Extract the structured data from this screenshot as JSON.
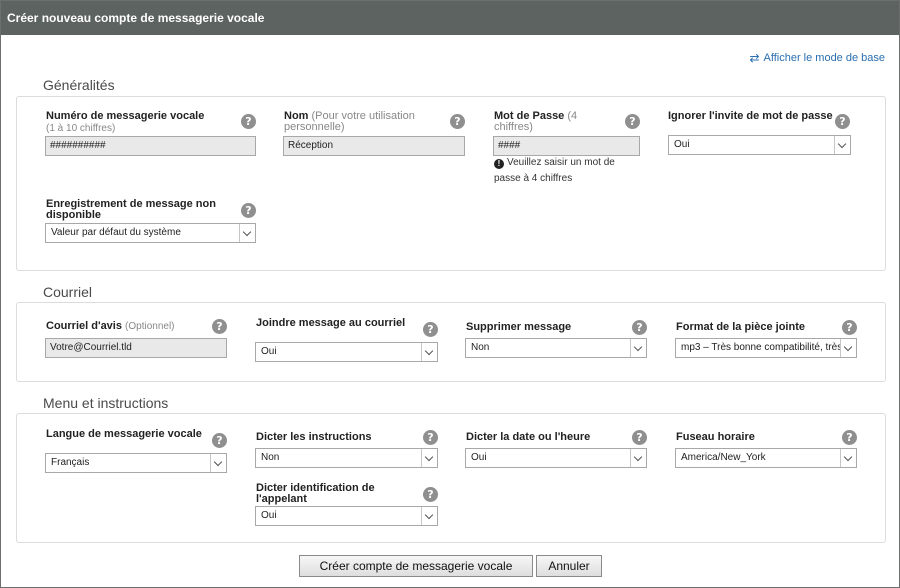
{
  "dialog": {
    "title": "Créer nouveau compte de messagerie vocale",
    "basic_mode_link": "Afficher le mode de base"
  },
  "general": {
    "title": "Généralités",
    "mailbox_number": {
      "label": "Numéro de messagerie vocale",
      "hint": "(1 à 10 chiffres)",
      "value": "##########"
    },
    "name": {
      "label": "Nom",
      "hint": "(Pour votre utilisation personnelle)",
      "value": "Réception"
    },
    "password": {
      "label": "Mot de Passe",
      "hint": "(4 chiffres)",
      "value": "####",
      "warning": "Veuillez saisir un mot de passe à 4 chiffres"
    },
    "skip_prompt": {
      "label": "Ignorer l'invite de mot de passe",
      "value": "Oui"
    },
    "unavailable_message": {
      "label": "Enregistrement de message non disponible",
      "value": "Valeur par défaut du système"
    }
  },
  "email": {
    "title": "Courriel",
    "notify_email": {
      "label": "Courriel d'avis",
      "hint": "(Optionnel)",
      "value": "Votre@Courriel.tld"
    },
    "attach": {
      "label": "Joindre message au courriel",
      "value": "Oui"
    },
    "delete": {
      "label": "Supprimer message",
      "value": "Non"
    },
    "format": {
      "label": "Format de la pièce jointe",
      "value": "mp3 – Très bonne compatibilité, très"
    }
  },
  "menu": {
    "title": "Menu et instructions",
    "language": {
      "label": "Langue de messagerie vocale",
      "value": "Français"
    },
    "instructions": {
      "label": "Dicter les instructions",
      "value": "Non"
    },
    "datetime": {
      "label": "Dicter la date ou l'heure",
      "value": "Oui"
    },
    "timezone": {
      "label": "Fuseau horaire",
      "value": "America/New_York"
    },
    "caller_id": {
      "label": "Dicter identification de l'appelant",
      "value": "Oui"
    }
  },
  "actions": {
    "create": "Créer compte de messagerie vocale",
    "cancel": "Annuler"
  },
  "icons": {
    "help": "?",
    "warning": "!",
    "swap": "⇄"
  }
}
